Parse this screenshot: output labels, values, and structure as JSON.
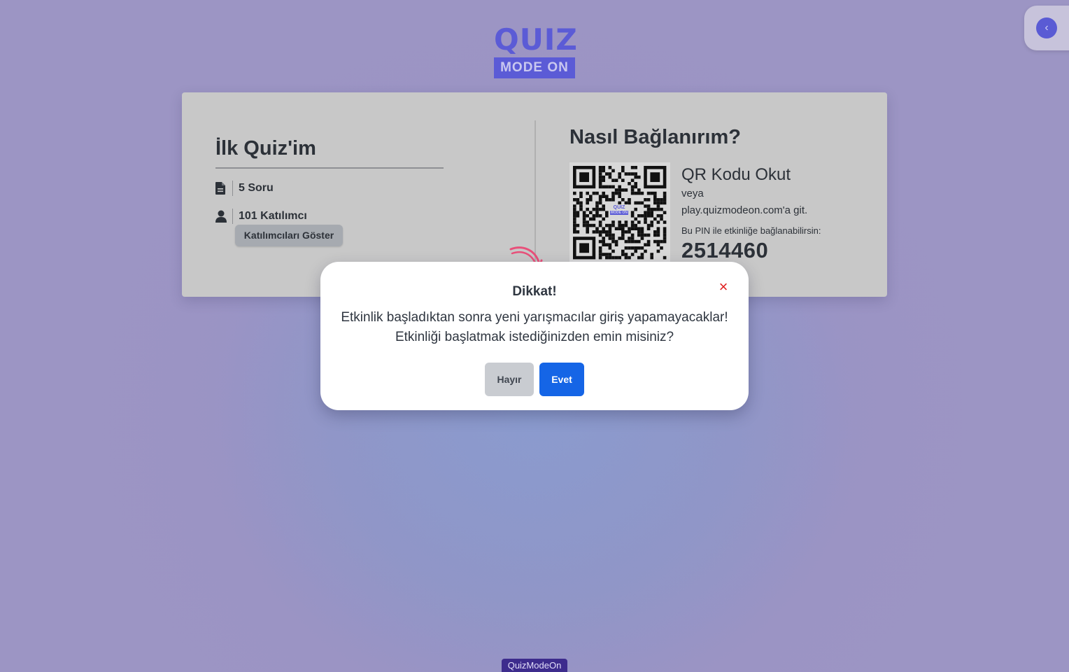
{
  "logo": {
    "top": "QUIZ",
    "bottom": "MODE ON"
  },
  "quiz": {
    "title": "İlk Quiz'im",
    "questions": "5 Soru",
    "participants": "101 Katılımcı",
    "show_participants_button": "Katılımcıları Göster"
  },
  "connect": {
    "title": "Nasıl Bağlanırım?",
    "qr_scan": "QR Kodu Okut",
    "or": "veya",
    "url_text": "play.quizmodeon.com'a git.",
    "pin_label": "Bu PIN ile etkinliğe bağlanabilirsin:",
    "pin": "2514460",
    "qr_logo_top": "QUIZ",
    "qr_logo_bottom": "MODE ON"
  },
  "modal": {
    "title": "Dikkat!",
    "message_line1": "Etkinlik başladıktan sonra yeni yarışmacılar giriş yapamayacaklar!",
    "message_line2": "Etkinliği başlatmak istediğinizden emin misiniz?",
    "no_button": "Hayır",
    "yes_button": "Evet",
    "close_symbol": "×"
  },
  "sidebar_toggle": {
    "icon": "chevron-left-icon",
    "symbol": "‹"
  },
  "footer": {
    "brand": "QuizModeOn"
  },
  "colors": {
    "brand": "#5b5bd6",
    "primary_button": "#1565e6",
    "danger": "#e02020",
    "footer_bg": "#3d2c8d"
  }
}
